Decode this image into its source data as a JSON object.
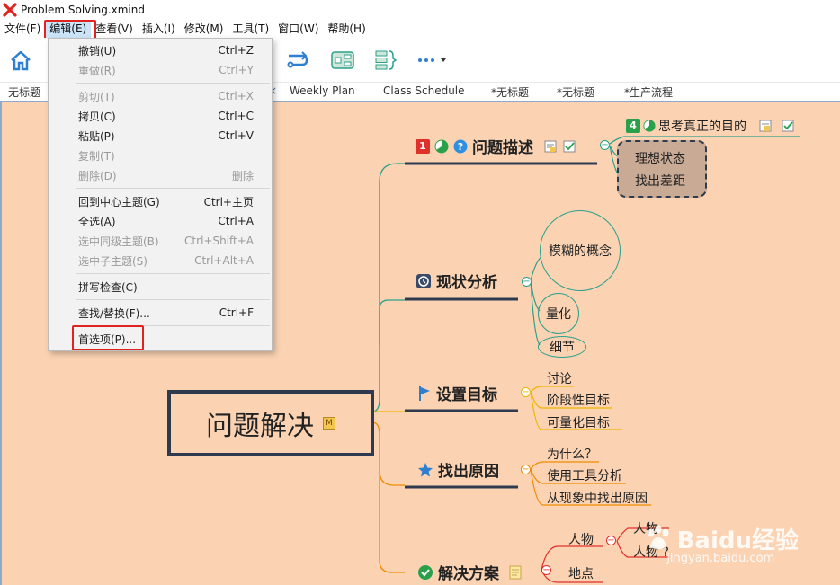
{
  "window": {
    "title": "Problem Solving.xmind"
  },
  "menubar": [
    {
      "label": "文件(F)"
    },
    {
      "label": "编辑(E)"
    },
    {
      "label": "查看(V)"
    },
    {
      "label": "插入(I)"
    },
    {
      "label": "修改(M)"
    },
    {
      "label": "工具(T)"
    },
    {
      "label": "窗口(W)"
    },
    {
      "label": "帮助(H)"
    }
  ],
  "tabs": [
    "无标题",
    "Weekly Plan",
    "Class Schedule",
    "*无标题",
    "*无标题",
    "*生产流程"
  ],
  "edit_menu": {
    "items": [
      {
        "label": "撤销(U)",
        "shortcut": "Ctrl+Z",
        "disabled": false
      },
      {
        "label": "重做(R)",
        "shortcut": "Ctrl+Y",
        "disabled": true
      },
      {
        "label": "剪切(T)",
        "shortcut": "Ctrl+X",
        "disabled": true
      },
      {
        "label": "拷贝(C)",
        "shortcut": "Ctrl+C",
        "disabled": false
      },
      {
        "label": "粘贴(P)",
        "shortcut": "Ctrl+V",
        "disabled": false
      },
      {
        "label": "复制(T)",
        "shortcut": "",
        "disabled": true
      },
      {
        "label": "删除(D)",
        "shortcut": "删除",
        "disabled": true
      },
      {
        "label": "回到中心主题(G)",
        "shortcut": "Ctrl+主页",
        "disabled": false
      },
      {
        "label": "全选(A)",
        "shortcut": "Ctrl+A",
        "disabled": false
      },
      {
        "label": "选中同级主题(B)",
        "shortcut": "Ctrl+Shift+A",
        "disabled": true
      },
      {
        "label": "选中子主题(S)",
        "shortcut": "Ctrl+Alt+A",
        "disabled": true
      },
      {
        "label": "拼写检查(C)",
        "shortcut": "",
        "disabled": false
      },
      {
        "label": "查找/替换(F)...",
        "shortcut": "Ctrl+F",
        "disabled": false
      },
      {
        "label": "首选项(P)...",
        "shortcut": "",
        "disabled": false
      }
    ]
  },
  "mindmap": {
    "central": "问题解决",
    "central_marker": "M",
    "topics": {
      "describe": {
        "label": "问题描述",
        "priority": "1",
        "children": {
          "think": {
            "label": "思考真正的目的",
            "badge": "4"
          },
          "ideal": "理想状态",
          "gap": "找出差距"
        }
      },
      "status": {
        "label": "现状分析",
        "children": [
          "模糊的概念",
          "量化",
          "细节"
        ]
      },
      "goal": {
        "label": "设置目标",
        "children": [
          "讨论",
          "阶段性目标",
          "可量化目标"
        ]
      },
      "cause": {
        "label": "找出原因",
        "children": [
          "为什么？",
          "使用工具分析",
          "从现象中找出原因"
        ]
      },
      "solution": {
        "label": "解决方案",
        "children": [
          "人物",
          "地点"
        ],
        "grandchildren": [
          "人物",
          "人物 ?"
        ]
      }
    }
  },
  "watermark": {
    "brand": "Baidu经验",
    "url": "jingyan.baidu.com"
  },
  "colors": {
    "canvas": "#fbd3b3",
    "central_border": "#2e3a4d",
    "highlight_box": "#e0231f",
    "teal_branch": "#2aa08b",
    "yellow_branch": "#f0b400",
    "orange_branch": "#f08a00",
    "red_branch": "#e0302a"
  }
}
